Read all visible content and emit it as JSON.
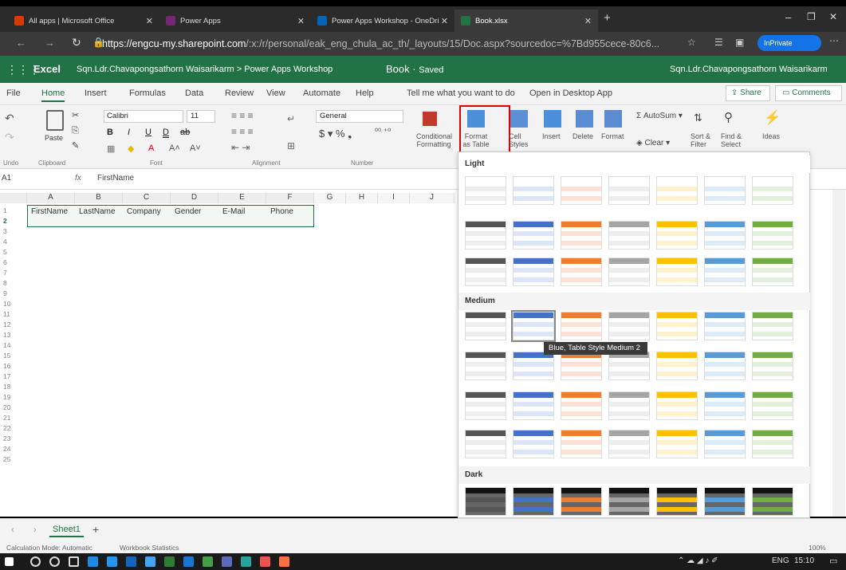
{
  "browser": {
    "tabs": [
      {
        "label": "All apps | Microsoft Office",
        "color": "#d83b01"
      },
      {
        "label": "Power Apps",
        "color": "#742774"
      },
      {
        "label": "Power Apps Workshop - OneDri",
        "color": "#0364b8"
      },
      {
        "label": "Book.xlsx",
        "color": "#217346"
      }
    ],
    "url_host": "https://engcu-my.sharepoint.com",
    "url_path": "/:x:/r/personal/eak_eng_chula_ac_th/_layouts/15/Doc.aspx?sourcedoc=%7Bd955cece-80c6...",
    "inprivate": "InPrivate"
  },
  "app": {
    "name": "Excel",
    "breadcrumb": "Sqn.Ldr.Chavapongsathorn Waisarikarm > Power Apps Workshop",
    "doc_title": "Book",
    "doc_status": "Saved",
    "user": "Sqn.Ldr.Chavapongsathorn Waisarikarm"
  },
  "ribbon_tabs": [
    "File",
    "Home",
    "Insert",
    "Formulas",
    "Data",
    "Review",
    "View",
    "Automate",
    "Help"
  ],
  "tell_me": "Tell me what you want to do",
  "open_desktop": "Open in Desktop App",
  "share": "Share",
  "comments": "Comments",
  "ribbon": {
    "undo": "Undo",
    "clipboard": "Clipboard",
    "paste": "Paste",
    "font_name": "Calibri",
    "font_size": "11",
    "font": "Font",
    "alignment": "Alignment",
    "number_format": "General",
    "number": "Number",
    "conditional": "Conditional",
    "formatting": "Formatting",
    "format_as": "Format",
    "as_table": "as Table",
    "cell_styles": "Cell",
    "styles": "Styles",
    "insert": "Insert",
    "delete": "Delete",
    "format": "Format",
    "autosum": "AutoSum",
    "clear": "Clear",
    "sort": "Sort &",
    "filter": "Filter",
    "find": "Find &",
    "select": "Select",
    "ideas": "Ideas"
  },
  "formula_bar": {
    "name_box": "A1",
    "fx": "fx",
    "content": "FirstName"
  },
  "columns": [
    "A",
    "B",
    "C",
    "D",
    "E",
    "F",
    "G",
    "H",
    "I",
    "J"
  ],
  "rows": [
    "1",
    "2",
    "3",
    "4",
    "5",
    "6",
    "7",
    "8",
    "9",
    "10",
    "11",
    "12",
    "13",
    "14",
    "15",
    "16",
    "17",
    "18",
    "19",
    "20",
    "21",
    "22",
    "23",
    "24",
    "25"
  ],
  "headers": [
    "FirstName",
    "LastName",
    "Company",
    "Gender",
    "E-Mail",
    "Phone"
  ],
  "gallery": {
    "light": "Light",
    "medium": "Medium",
    "dark": "Dark"
  },
  "tooltip": "Blue, Table Style Medium 2",
  "sheet": {
    "tab": "Sheet1",
    "add": "+"
  },
  "status": {
    "calc": "Calculation Mode: Automatic",
    "stats": "Workbook Statistics",
    "zoom": "100%"
  },
  "taskbar": {
    "lang": "ENG",
    "time": "15:10"
  }
}
